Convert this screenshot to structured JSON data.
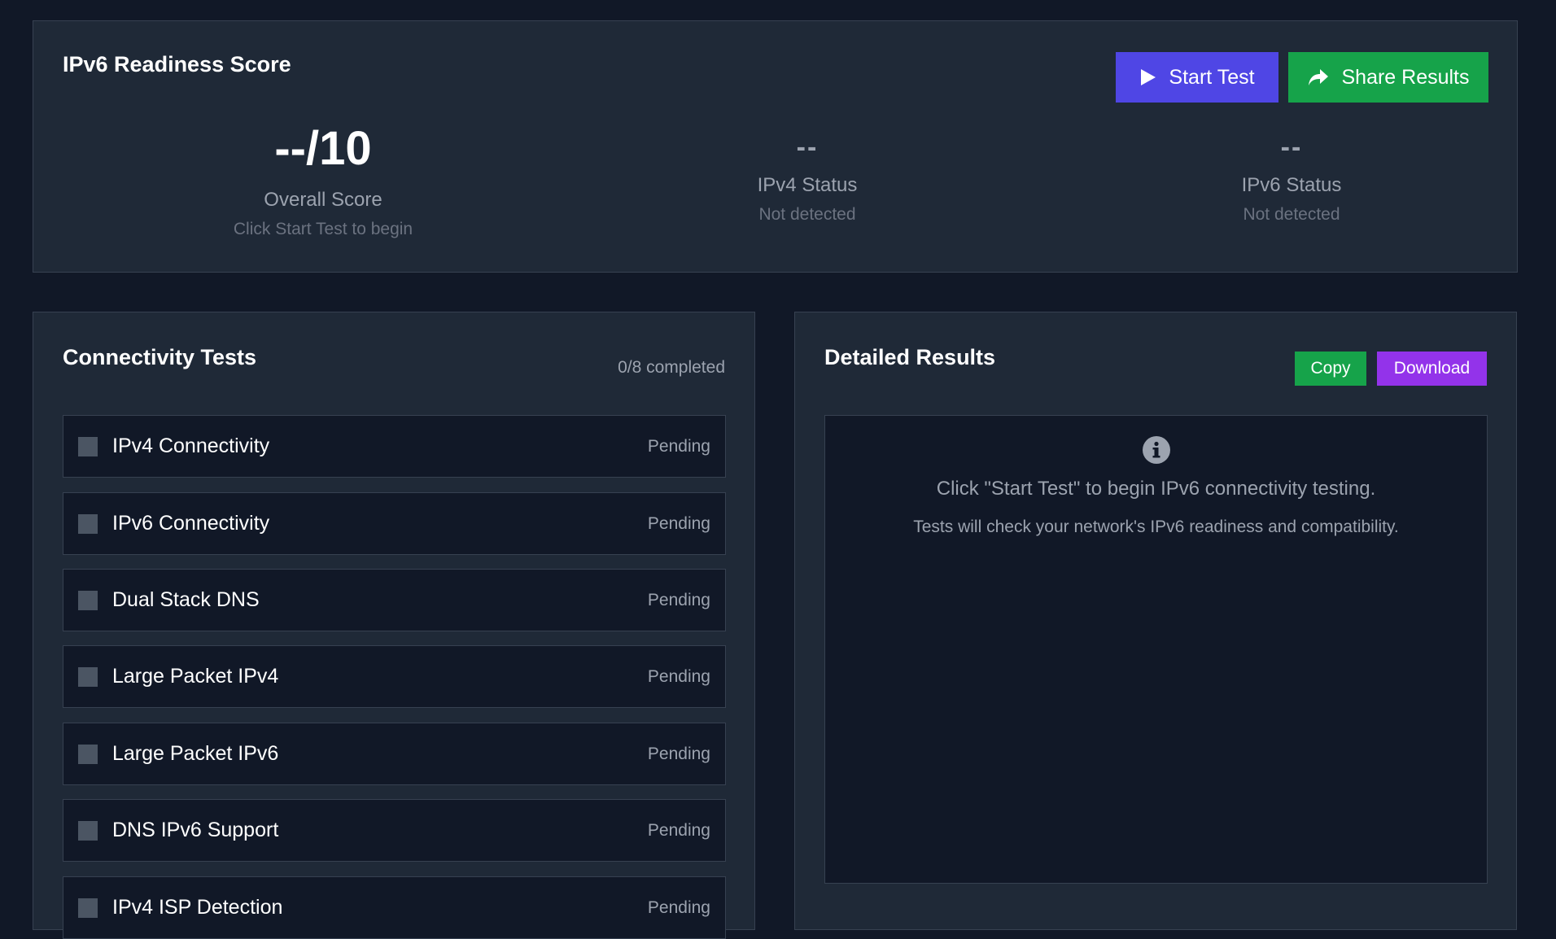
{
  "score_panel": {
    "title": "IPv6 Readiness Score",
    "start_label": "Start Test",
    "share_label": "Share Results",
    "overall": {
      "value": "--/10",
      "label": "Overall Score",
      "sub": "Click Start Test to begin"
    },
    "ipv4": {
      "value": "--",
      "label": "IPv4 Status",
      "sub": "Not detected"
    },
    "ipv6": {
      "value": "--",
      "label": "IPv6 Status",
      "sub": "Not detected"
    }
  },
  "tests_panel": {
    "title": "Connectivity Tests",
    "count": "0/8 completed",
    "items": [
      {
        "name": "IPv4 Connectivity",
        "status": "Pending"
      },
      {
        "name": "IPv6 Connectivity",
        "status": "Pending"
      },
      {
        "name": "Dual Stack DNS",
        "status": "Pending"
      },
      {
        "name": "Large Packet IPv4",
        "status": "Pending"
      },
      {
        "name": "Large Packet IPv6",
        "status": "Pending"
      },
      {
        "name": "DNS IPv6 Support",
        "status": "Pending"
      },
      {
        "name": "IPv4 ISP Detection",
        "status": "Pending"
      }
    ]
  },
  "results_panel": {
    "title": "Detailed Results",
    "copy_label": "Copy",
    "download_label": "Download",
    "message": "Click \"Start Test\" to begin IPv6 connectivity testing.",
    "sub_message": "Tests will check your network's IPv6 readiness and compatibility."
  },
  "icons": {
    "start": "play-icon",
    "share": "share-icon",
    "info": "info-icon"
  },
  "colors": {
    "primary": "#4f46e5",
    "success": "#16a34a",
    "accent": "#9333ea"
  }
}
